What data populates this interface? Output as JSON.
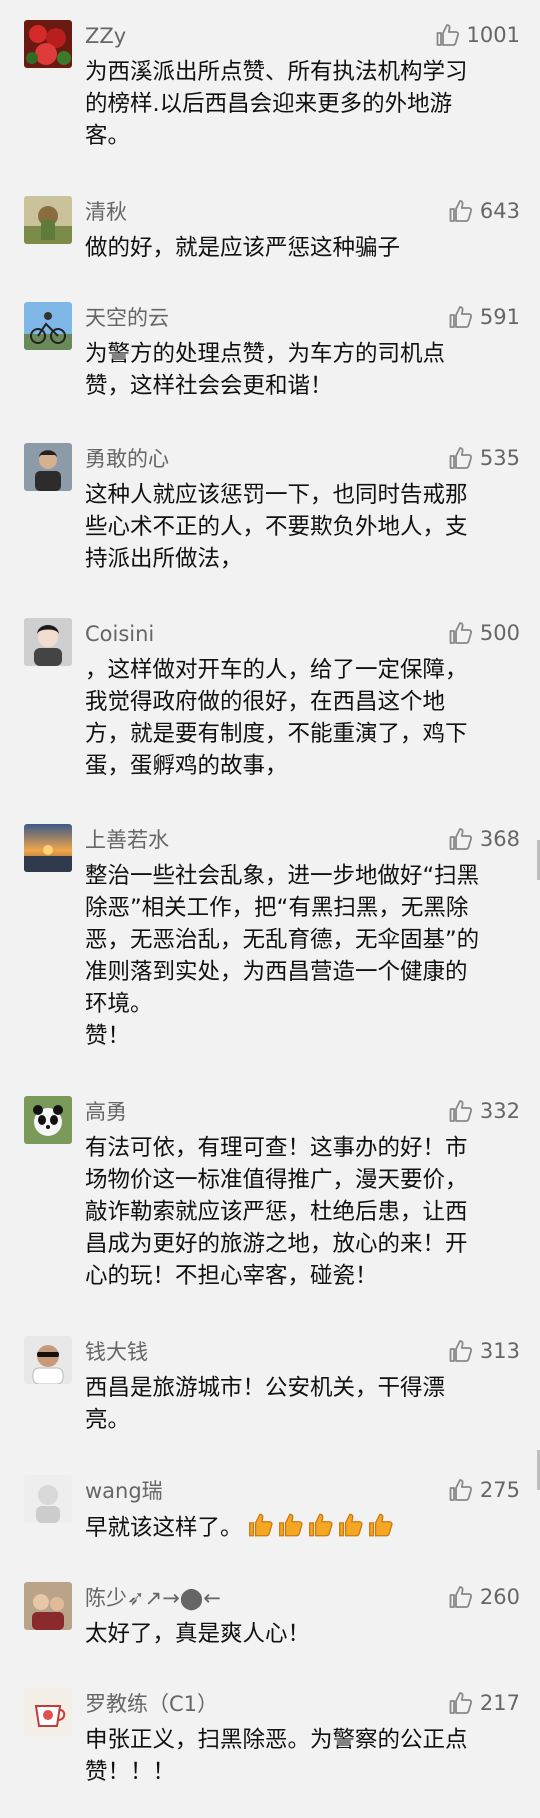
{
  "comments": [
    {
      "user": "ZZy",
      "likes": "1001",
      "text": "为西溪派出所点赞、所有执法机构学习\n的榜样.以后西昌会迎来更多的外地游\n客。"
    },
    {
      "user": "清秋",
      "likes": "643",
      "text": "做的好，就是应该严惩这种骗子"
    },
    {
      "user": "天空的云",
      "likes": "591",
      "text": "为警方的处理点赞，为车方的司机点\n赞，这样社会会更和谐！"
    },
    {
      "user": "勇敢的心",
      "likes": "535",
      "text": "这种人就应该惩罚一下，也同时告戒那\n些心术不正的人，不要欺负外地人，支\n持派出所做法，"
    },
    {
      "user": "Coisini",
      "likes": "500",
      "text": "，这样做对开车的人，给了一定保障，\n我觉得政府做的很好，在西昌这个地\n方，就是要有制度，不能重演了，鸡下\n蛋，蛋孵鸡的故事，"
    },
    {
      "user": "上善若水",
      "likes": "368",
      "text": "整治一些社会乱象，进一步地做好“扫黑\n除恶”相关工作，把“有黑扫黑，无黑除\n恶，无恶治乱，无乱育德，无伞固基”的\n准则落到实处，为西昌营造一个健康的\n环境。\n   赞！"
    },
    {
      "user": "高勇",
      "likes": "332",
      "text": "有法可依，有理可查！这事办的好！市\n场物价这一标准值得推广，漫天要价，\n敲诈勒索就应该严惩，杜绝后患，让西\n昌成为更好的旅游之地，放心的来！开\n心的玩！不担心宰客，碰瓷！"
    },
    {
      "user": "钱大钱",
      "likes": "313",
      "text": "西昌是旅游城市！公安机关，干得漂\n亮。"
    },
    {
      "user": "wang瑞",
      "likes": "275",
      "text": "早就该这样了。"
    },
    {
      "user": "陈少➶↗→⬤←",
      "likes": "260",
      "text": "太好了，真是爽人心！"
    },
    {
      "user": "罗教练（C1）",
      "likes": "217",
      "text": "申张正义，扫黑除恶。为警察的公正点\n赞！！！"
    }
  ],
  "icons": {
    "like": "thumbs-up-outline-icon",
    "emoji": "thumbs-up-emoji-icon"
  },
  "colors": {
    "background": "#f2f2f2",
    "username": "#666666",
    "text": "#111111",
    "icon": "#888888",
    "emoji": "#f5a623"
  }
}
